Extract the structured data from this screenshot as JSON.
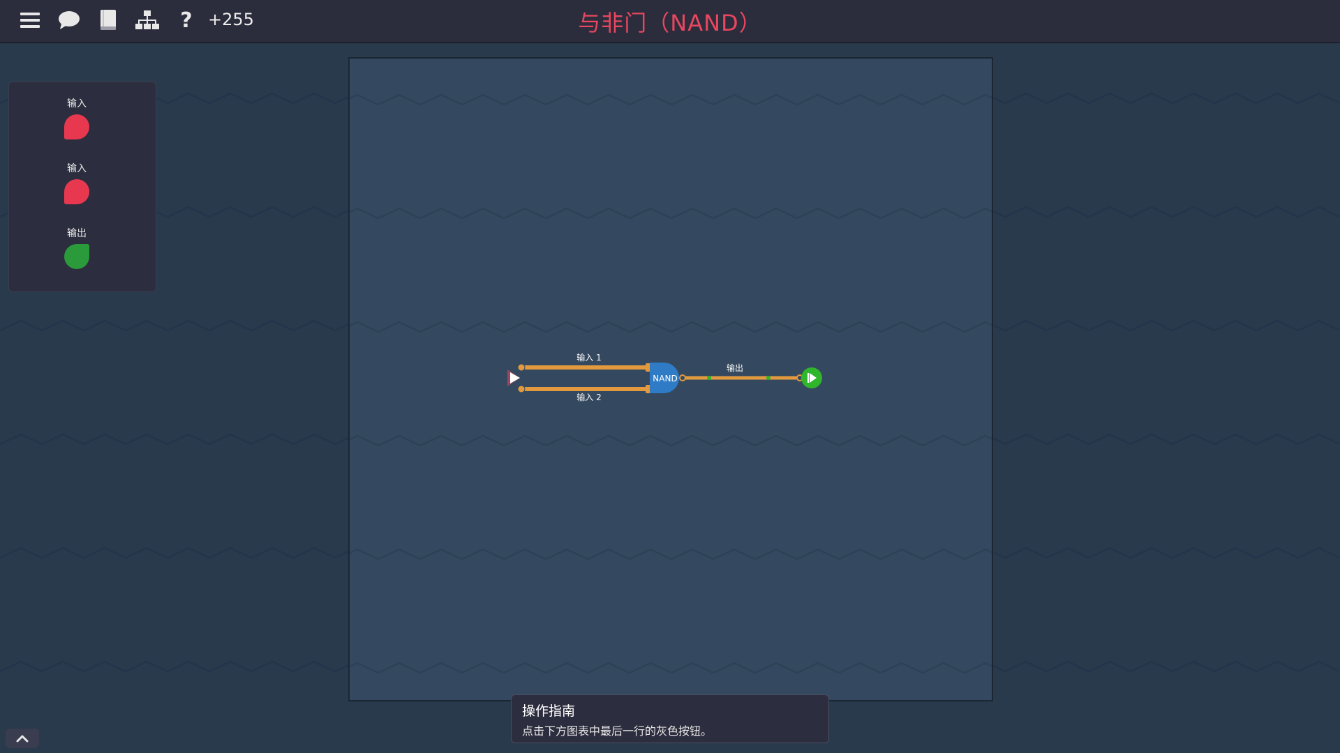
{
  "topbar": {
    "score": "+255",
    "title": "与非门（NAND）",
    "icons": [
      "menu-icon",
      "chat-icon",
      "book-icon",
      "hierarchy-icon",
      "help-icon"
    ]
  },
  "palette": {
    "items": [
      {
        "label": "输入",
        "color": "#e8384f"
      },
      {
        "label": "输入",
        "color": "#e8384f"
      },
      {
        "label": "输出",
        "color": "#2a9a3a"
      }
    ]
  },
  "circuit": {
    "input1_label": "输入 1",
    "input2_label": "输入 2",
    "gate_label": "NAND",
    "output_label": "输出",
    "wire_color": "#e39a3e",
    "gate_color": "#2f7bc6",
    "input_color": "#e8475f",
    "output_color": "#2fb62a"
  },
  "guide": {
    "title": "操作指南",
    "text": "点击下方图表中最后一行的灰色按钮。"
  }
}
